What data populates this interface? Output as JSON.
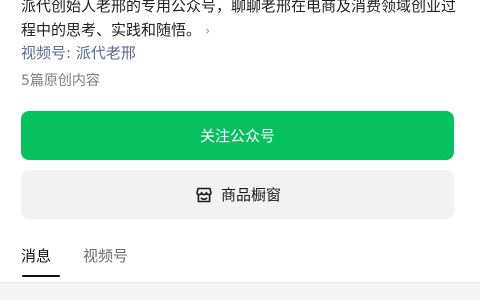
{
  "profile": {
    "description": "派代创始人老邢的专用公众号，聊聊老邢在电商及消费领域创业过程中的思考、实践和随悟。",
    "channel_link": "视频号: 派代老邢",
    "article_count": "5篇原创内容"
  },
  "actions": {
    "follow_label": "关注公众号",
    "shop_label": "商品橱窗",
    "shop_icon": "shop-icon"
  },
  "tabs": [
    {
      "label": "消息",
      "active": true
    },
    {
      "label": "视频号",
      "active": false
    }
  ],
  "colors": {
    "accent": "#07c160",
    "link": "#576b95",
    "secondary_button": "#f2f2f2"
  }
}
